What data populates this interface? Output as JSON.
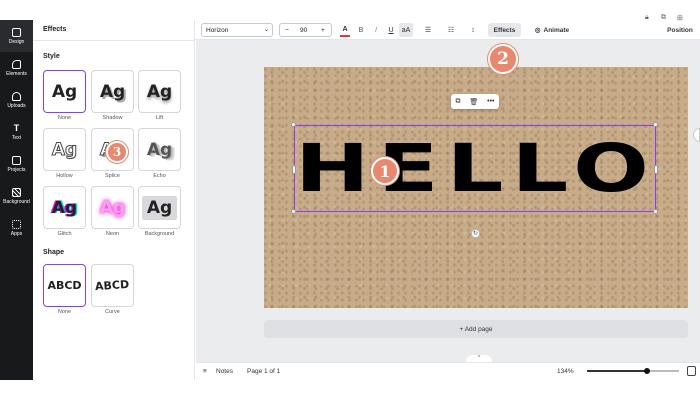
{
  "sidebar": {
    "items": [
      {
        "label": "Design",
        "icon": "layout-icon"
      },
      {
        "label": "Elements",
        "icon": "shapes-icon"
      },
      {
        "label": "Uploads",
        "icon": "cloud-upload-icon"
      },
      {
        "label": "Text",
        "icon": "text-icon"
      },
      {
        "label": "Projects",
        "icon": "folder-icon"
      },
      {
        "label": "Background",
        "icon": "pattern-icon"
      },
      {
        "label": "Apps",
        "icon": "apps-grid-icon"
      }
    ]
  },
  "effects_panel": {
    "title": "Effects",
    "style_section": "Style",
    "styles": [
      {
        "label": "None",
        "sample": "Ag"
      },
      {
        "label": "Shadow",
        "sample": "Ag"
      },
      {
        "label": "Lift",
        "sample": "Ag"
      },
      {
        "label": "Hollow",
        "sample": "Ag"
      },
      {
        "label": "Splice",
        "sample": "Ag"
      },
      {
        "label": "Echo",
        "sample": "Ag"
      },
      {
        "label": "Glitch",
        "sample": "Ag"
      },
      {
        "label": "Neon",
        "sample": "Ag"
      },
      {
        "label": "Background",
        "sample": "Ag"
      }
    ],
    "selected_style": "None",
    "shape_section": "Shape",
    "shapes": [
      {
        "label": "None",
        "sample": "ABCD"
      },
      {
        "label": "Curve",
        "sample": "ABCD"
      }
    ],
    "selected_shape": "None"
  },
  "toolbar": {
    "font": "Horizon",
    "font_size": "90",
    "minus": "−",
    "plus": "+",
    "text_color_glyph": "A",
    "bold": "B",
    "italic": "I",
    "underline": "U",
    "case": "aA",
    "effects_label": "Effects",
    "animate_label": "Animate",
    "position_label": "Position"
  },
  "canvas": {
    "text": "HELLO",
    "add_page_label": "+ Add page"
  },
  "bottom": {
    "notes_label": "Notes",
    "page_indicator": "Page 1 of 1",
    "zoom": "134%",
    "zoom_fraction": 0.65
  },
  "callouts": [
    "1",
    "2",
    "3"
  ],
  "colors": {
    "accent": "#8b3dff",
    "callout": "#e8886f",
    "rail": "#18191b",
    "kraft": "#c8ab88"
  }
}
